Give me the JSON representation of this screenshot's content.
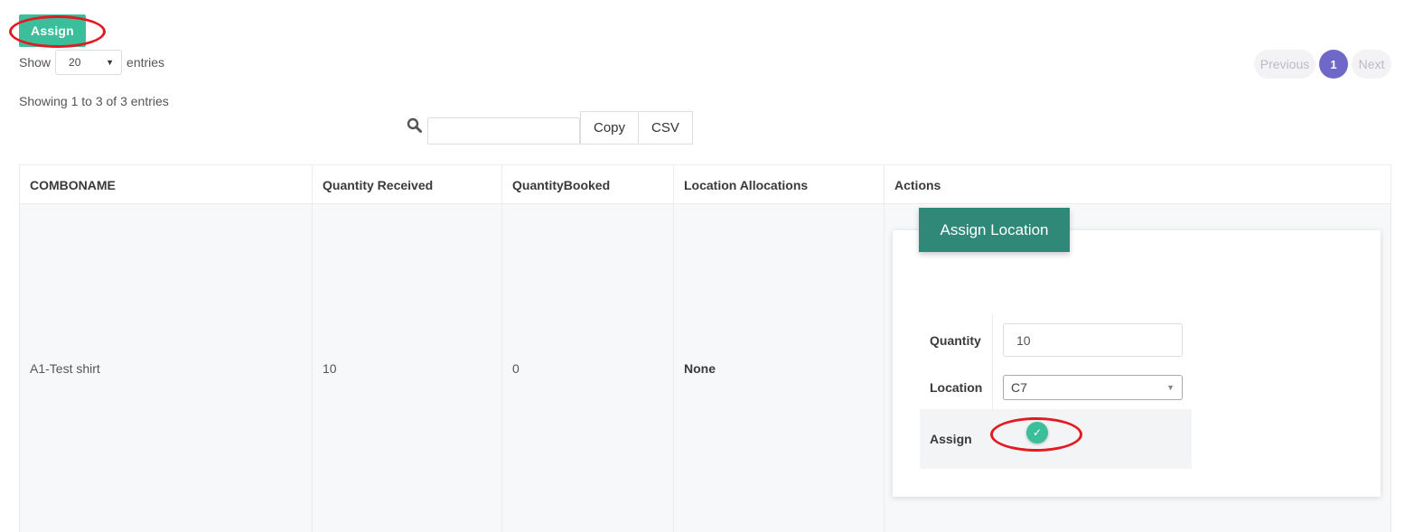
{
  "toolbar": {
    "assign_label": "Assign"
  },
  "length_menu": {
    "show_label": "Show",
    "value": "20",
    "entries_label": "entries"
  },
  "info_text": "Showing 1 to 3 of 3 entries",
  "pagination": {
    "previous": "Previous",
    "current": "1",
    "next": "Next"
  },
  "search": {
    "placeholder": "",
    "value": ""
  },
  "buttons": {
    "copy": "Copy",
    "csv": "CSV"
  },
  "table": {
    "headers": [
      "COMBONAME",
      "Quantity Received",
      "QuantityBooked",
      "Location Allocations",
      "Actions"
    ],
    "rows": [
      {
        "comboname": "A1-Test shirt",
        "quantity_received": "10",
        "quantity_booked": "0",
        "location_allocations": "None"
      }
    ]
  },
  "assign_card": {
    "title": "Assign Location",
    "quantity_label": "Quantity",
    "quantity_value": "10",
    "location_label": "Location",
    "location_value": "C7",
    "assign_label": "Assign",
    "assign_checked": true
  },
  "colors": {
    "accent_green": "#3bbf9b",
    "card_header": "#2f8878",
    "pager_active": "#6f68c9",
    "annotation_red": "#e21a22"
  },
  "icons": {
    "search": "search-icon",
    "check": "check-icon",
    "caret": "caret-down-icon"
  }
}
